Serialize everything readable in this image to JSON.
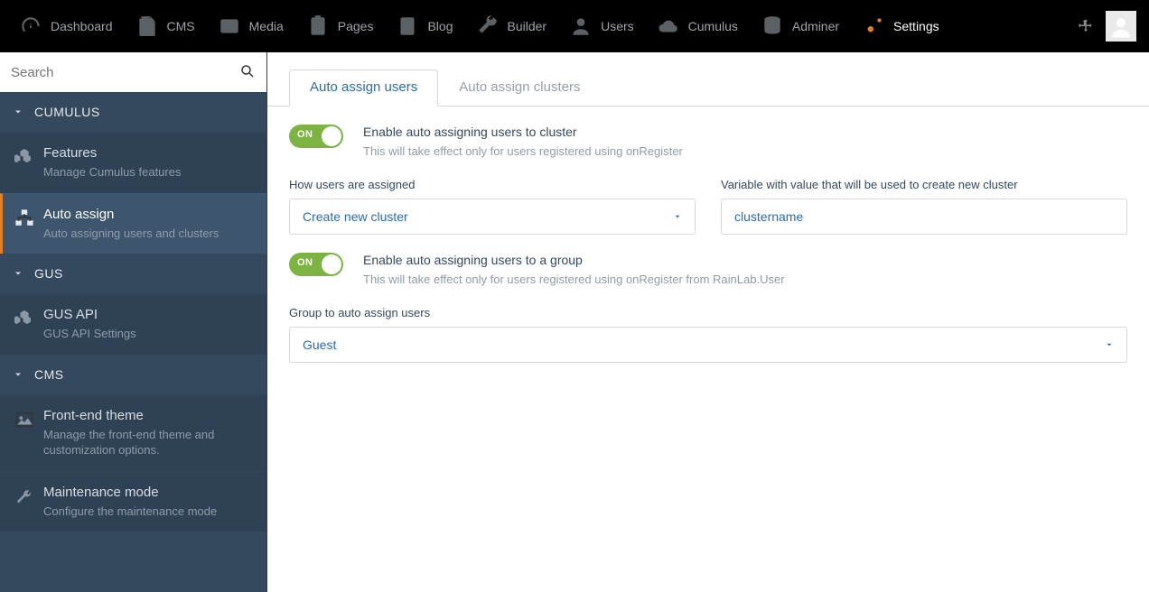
{
  "topnav": {
    "items": [
      {
        "label": "Dashboard"
      },
      {
        "label": "CMS"
      },
      {
        "label": "Media"
      },
      {
        "label": "Pages"
      },
      {
        "label": "Blog"
      },
      {
        "label": "Builder"
      },
      {
        "label": "Users"
      },
      {
        "label": "Cumulus"
      },
      {
        "label": "Adminer"
      },
      {
        "label": "Settings"
      }
    ]
  },
  "search": {
    "placeholder": "Search"
  },
  "sidebar": {
    "sections": [
      {
        "title": "CUMULUS",
        "items": [
          {
            "title": "Features",
            "sub": "Manage Cumulus features"
          },
          {
            "title": "Auto assign",
            "sub": "Auto assigning users and clusters"
          }
        ]
      },
      {
        "title": "GUS",
        "items": [
          {
            "title": "GUS API",
            "sub": "GUS API Settings"
          }
        ]
      },
      {
        "title": "CMS",
        "items": [
          {
            "title": "Front-end theme",
            "sub": "Manage the front-end theme and customization options."
          },
          {
            "title": "Maintenance mode",
            "sub": "Configure the maintenance mode"
          }
        ]
      }
    ]
  },
  "tabs": [
    {
      "label": "Auto assign users"
    },
    {
      "label": "Auto assign clusters"
    }
  ],
  "form": {
    "toggle1": {
      "on": "ON",
      "title": "Enable auto assigning users to cluster",
      "desc": "This will take effect only for users registered using onRegister"
    },
    "assignLabel": "How users are assigned",
    "assignValue": "Create new cluster",
    "varLabel": "Variable with value that will be used to create new cluster",
    "varValue": "clustername",
    "toggle2": {
      "on": "ON",
      "title": "Enable auto assigning users to a group",
      "desc": "This will take effect only for users registered using onRegister from RainLab.User"
    },
    "groupLabel": "Group to auto assign users",
    "groupValue": "Guest"
  }
}
